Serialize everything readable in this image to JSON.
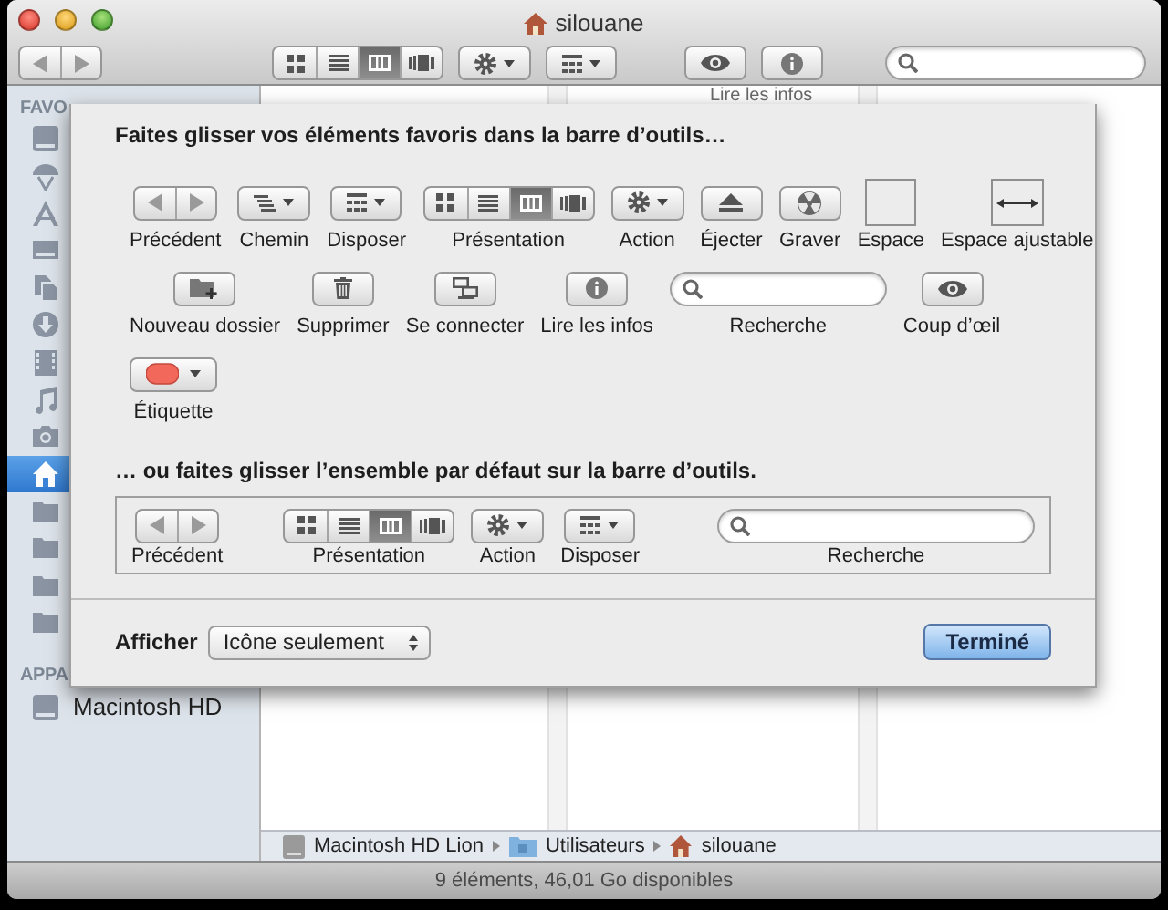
{
  "window": {
    "title": "silouane"
  },
  "toolbar": {
    "items": [
      {
        "kind": "nav"
      },
      {
        "kind": "view",
        "segments": [
          {
            "selected": false
          },
          {
            "selected": false
          },
          {
            "selected": true
          },
          {
            "selected": false
          }
        ]
      },
      {
        "kind": "action"
      },
      {
        "kind": "arrange"
      },
      {
        "kind": "quicklook"
      },
      {
        "kind": "info"
      },
      {
        "kind": "search"
      }
    ],
    "tooltip": "Lire les infos"
  },
  "sidebar": {
    "sections": [
      {
        "header": "FAVO",
        "items": [
          {
            "kind": "drive",
            "selected": false
          },
          {
            "kind": "airdrop",
            "selected": false
          },
          {
            "kind": "apps",
            "selected": false
          },
          {
            "kind": "desktop",
            "selected": false
          },
          {
            "kind": "documents",
            "selected": false
          },
          {
            "kind": "downloads",
            "selected": false
          },
          {
            "kind": "movies",
            "selected": false
          },
          {
            "kind": "music",
            "selected": false
          },
          {
            "kind": "pictures",
            "selected": false
          },
          {
            "kind": "home",
            "selected": true
          },
          {
            "kind": "folder",
            "selected": false
          },
          {
            "kind": "folder",
            "selected": false
          },
          {
            "kind": "folder",
            "selected": false
          },
          {
            "kind": "folder",
            "selected": false
          }
        ]
      },
      {
        "header": "APPA",
        "items": [
          {
            "kind": "drive",
            "label": "Macintosh HD",
            "selected": false
          }
        ]
      }
    ]
  },
  "path_bar": [
    {
      "kind": "drive",
      "label": "Macintosh HD Lion"
    },
    {
      "kind": "folder",
      "label": "Utilisateurs"
    },
    {
      "kind": "home",
      "label": "silouane"
    }
  ],
  "status_bar": "9 éléments, 46,01 Go disponibles",
  "customize_sheet": {
    "heading": "Faites glisser vos éléments favoris dans la barre d’outils…",
    "palette_rows": [
      [
        {
          "kind": "nav",
          "label": "Précédent"
        },
        {
          "kind": "path",
          "label": "Chemin"
        },
        {
          "kind": "arrange",
          "label": "Disposer"
        },
        {
          "kind": "view",
          "label": "Présentation",
          "segments": [
            {
              "selected": false
            },
            {
              "selected": false
            },
            {
              "selected": true
            },
            {
              "selected": false
            }
          ]
        },
        {
          "kind": "action",
          "label": "Action"
        },
        {
          "kind": "eject",
          "label": "Éjecter"
        },
        {
          "kind": "burn",
          "label": "Graver"
        },
        {
          "kind": "space",
          "label": "Espace"
        },
        {
          "kind": "flexspace",
          "label": "Espace ajustable"
        }
      ],
      [
        {
          "kind": "newfolder",
          "label": "Nouveau dossier"
        },
        {
          "kind": "delete",
          "label": "Supprimer"
        },
        {
          "kind": "connect",
          "label": "Se connecter"
        },
        {
          "kind": "info",
          "label": "Lire les infos"
        },
        {
          "kind": "search",
          "label": "Recherche"
        },
        {
          "kind": "quicklook",
          "label": "Coup d’œil"
        }
      ],
      [
        {
          "kind": "label",
          "label": "Étiquette"
        }
      ]
    ],
    "default_heading": "… ou faites glisser l’ensemble par défaut sur la barre d’outils.",
    "default_set": [
      {
        "kind": "nav",
        "label": "Précédent"
      },
      {
        "kind": "view",
        "label": "Présentation",
        "segments": [
          {
            "selected": false
          },
          {
            "selected": false
          },
          {
            "selected": true
          },
          {
            "selected": false
          }
        ]
      },
      {
        "kind": "action",
        "label": "Action"
      },
      {
        "kind": "arrange",
        "label": "Disposer"
      },
      {
        "kind": "search",
        "label": "Recherche"
      }
    ],
    "show_label": "Afficher",
    "show_value": "Icône seulement",
    "done_button": "Terminé"
  }
}
